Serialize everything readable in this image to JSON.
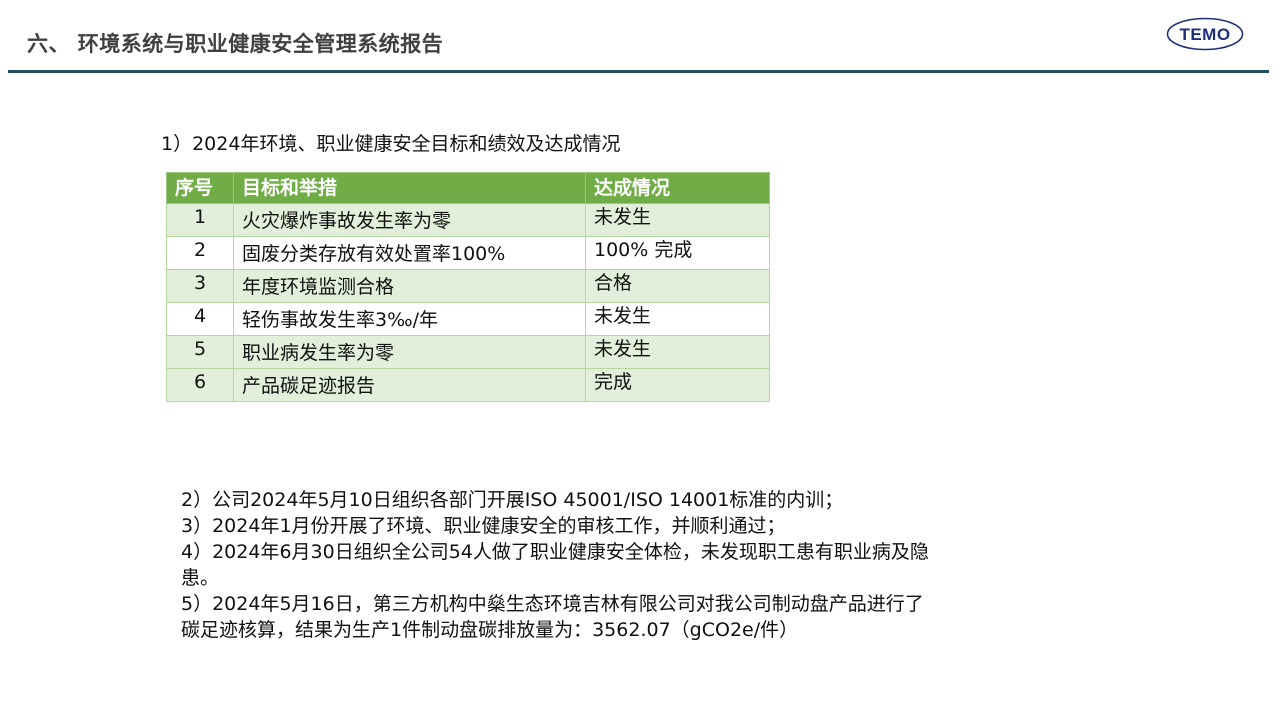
{
  "header": {
    "title": "六、 环境系统与职业健康安全管理系统报告",
    "logo_text": "TEMO"
  },
  "subtitle": "1）2024年环境、职业健康安全目标和绩效及达成情况",
  "table": {
    "headers": [
      "序号",
      "目标和举措",
      "达成情况"
    ],
    "rows": [
      {
        "num": "1",
        "goal": "火灾爆炸事故发生率为零",
        "status": "未发生"
      },
      {
        "num": "2",
        "goal": "固废分类存放有效处置率100%",
        "status": "100% 完成"
      },
      {
        "num": "3",
        "goal": "年度环境监测合格",
        "status": "合格"
      },
      {
        "num": "4",
        "goal": "轻伤事故发生率3‰/年",
        "status": "未发生"
      },
      {
        "num": "5",
        "goal": "职业病发生率为零",
        "status": "未发生"
      },
      {
        "num": "6",
        "goal": "产品碳足迹报告",
        "status": "完成"
      }
    ]
  },
  "notes": [
    "2）公司2024年5月10日组织各部门开展ISO 45001/ISO 14001标准的内训；",
    "3）2024年1月份开展了环境、职业健康安全的审核工作，并顺利通过；",
    "4）2024年6月30日组织全公司54人做了职业健康安全体检，未发现职工患有职业病及隐患。",
    "5）2024年5月16日，第三方机构中燊生态环境吉林有限公司对我公司制动盘产品进行了碳足迹核算，结果为生产1件制动盘碳排放量为：3562.07（gCO2e/件）"
  ],
  "colors": {
    "header_green": "#70ad47",
    "row_light_green": "#e2efda",
    "rule": "#1f4e5f",
    "logo_blue": "#1f2f7a"
  }
}
